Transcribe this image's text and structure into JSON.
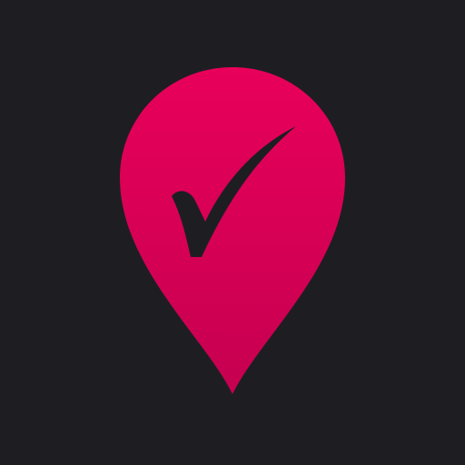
{
  "app_icon": {
    "icon": "location-pin-check-icon",
    "colors": {
      "background": "#1e1e22",
      "pin_top": "#e8005a",
      "pin_bottom": "#c60050",
      "checkmark": "#1e1e22"
    }
  }
}
